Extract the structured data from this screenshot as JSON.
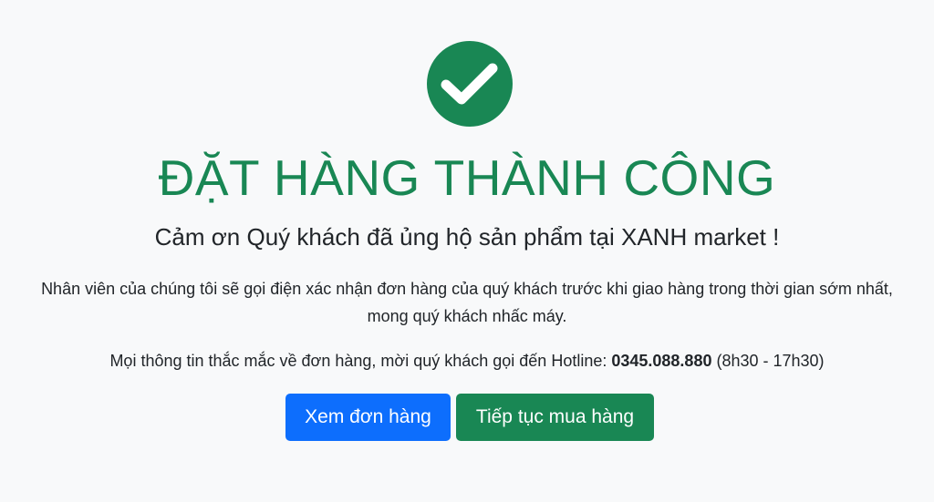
{
  "status_icon": {
    "name": "check-circle-icon",
    "color": "#198754"
  },
  "title": "ĐẶT HÀNG THÀNH CÔNG",
  "subtitle": "Cảm ơn Quý khách đã ủng hộ sản phẩm tại XANH market !",
  "notice": "Nhân viên của chúng tôi sẽ gọi điện xác nhận đơn hàng của quý khách trước khi giao hàng trong thời gian sớm nhất, mong quý khách nhấc máy.",
  "hotline": {
    "prefix": "Mọi thông tin thắc mắc về đơn hàng, mời quý khách gọi đến Hotline: ",
    "number": "0345.088.880",
    "hours": " (8h30 - 17h30)"
  },
  "actions": {
    "view_orders": "Xem đơn hàng",
    "continue_shopping": "Tiếp tục mua hàng"
  },
  "colors": {
    "success": "#198754",
    "primary": "#0d6efd",
    "background": "#f8f9fa"
  }
}
